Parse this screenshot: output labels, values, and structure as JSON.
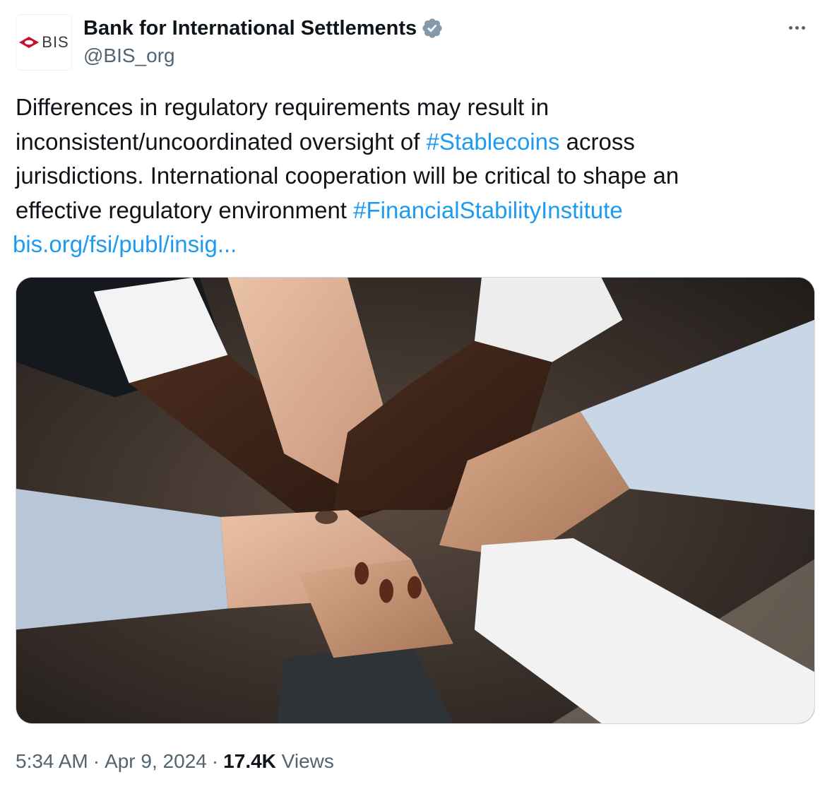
{
  "account": {
    "display_name": "Bank for International Settlements",
    "handle": "@BIS_org",
    "avatar_text": "BIS",
    "brand_color": "#c8102e",
    "verified_color": "#829aab"
  },
  "tweet": {
    "lines": [
      [
        {
          "text": "Differences in regulatory requirements may result in",
          "link": false
        }
      ],
      [
        {
          "text": "inconsistent/uncoordinated oversight of ",
          "link": false
        },
        {
          "text": "#Stablecoins",
          "link": true
        },
        {
          "text": " across",
          "link": false
        }
      ],
      [
        {
          "text": "jurisdictions. International cooperation will be critical to shape an",
          "link": false
        }
      ],
      [
        {
          "text": "effective regulatory environment ",
          "link": false
        },
        {
          "text": "#FinancialStabilityInstitute",
          "link": true
        }
      ]
    ],
    "url": "bis.org/fsi/publ/insig..."
  },
  "meta": {
    "time": "5:34 AM",
    "separator": "·",
    "date": "Apr 9, 2024",
    "views_count": "17.4K",
    "views_label": "Views"
  },
  "icons": {
    "more": "more-dots-icon",
    "verified": "verified-badge-icon"
  },
  "colors": {
    "link": "#1d9bf0",
    "secondary_text": "#536471",
    "primary_text": "#0f1419"
  }
}
